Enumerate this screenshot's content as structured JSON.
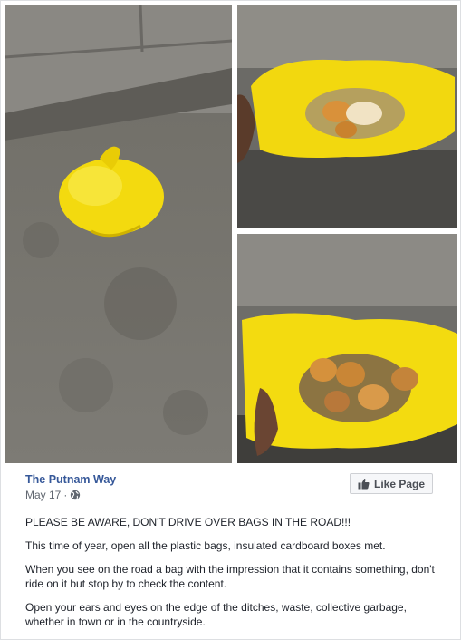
{
  "post": {
    "page_name": "The Putnam Way",
    "date": "May 17",
    "separator": "·",
    "privacy_icon": "globe-icon",
    "like_button_label": "Like Page",
    "like_icon": "thumbs-up-icon",
    "paragraphs": [
      "PLEASE BE AWARE, DON'T DRIVE OVER BAGS IN THE ROAD!!!",
      "This time of year, open all the plastic bags, insulated cardboard boxes met.",
      "When you see on the road a bag with the impression that it contains something, don't ride on it but stop by to check the content.",
      "Open your ears and eyes on the edge of the ditches, waste, collective garbage, whether in town or in the countryside."
    ]
  },
  "colors": {
    "link": "#365899",
    "meta": "#616770",
    "text": "#1d2129",
    "bag_yellow": "#f2d90e"
  }
}
